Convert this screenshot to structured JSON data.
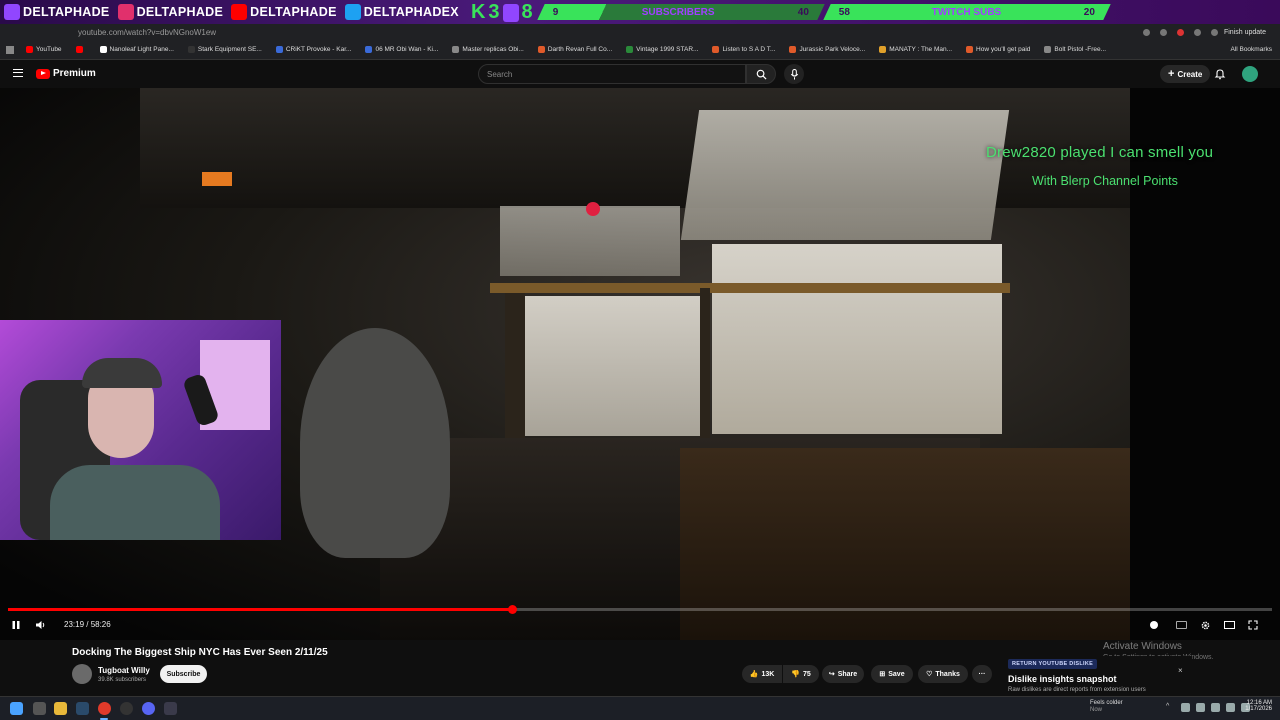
{
  "overlay_banner": {
    "socials": [
      {
        "icon": "twitch-icon",
        "handle": "DELTAPHADE",
        "color": "#9146ff"
      },
      {
        "icon": "instagram-icon",
        "handle": "DELTAPHADE",
        "color": "#e1306c"
      },
      {
        "icon": "youtube-icon",
        "handle": "DELTAPHADE",
        "color": "#ff0000"
      },
      {
        "icon": "twitter-icon",
        "handle": "DELTAPHADEX",
        "color": "#1da1f2"
      }
    ],
    "k38_letters": [
      "K",
      "3",
      "8"
    ],
    "subscribers": {
      "current": "9",
      "label": "SUBSCRIBERS",
      "goal": "40"
    },
    "twitch_subs": {
      "current": "58",
      "label": "TWITCH SUBS",
      "goal": "20"
    },
    "accent_green": "#39e35a"
  },
  "browser": {
    "url": "youtube.com/watch?v=dbvNGnoW1ew",
    "finish_update": "Finish update",
    "bookmarks": [
      {
        "label": "YouTube",
        "color": "#ff0000"
      },
      {
        "label": "",
        "color": "#ff0000"
      },
      {
        "label": "Nanoleaf Light Pane...",
        "color": "#ffffff"
      },
      {
        "label": "Stark Equipment SE...",
        "color": "#333333"
      },
      {
        "label": "CRiKT Provoke - Kar...",
        "color": "#3a6ad8"
      },
      {
        "label": "06 MR Obi Wan - Ki...",
        "color": "#3a6ad8"
      },
      {
        "label": "Master replicas Obi...",
        "color": "#888888"
      },
      {
        "label": "Darth Revan Full Co...",
        "color": "#e05a2a"
      },
      {
        "label": "Vintage 1999 STAR...",
        "color": "#2a8a3a"
      },
      {
        "label": "Listen to S A D  T...",
        "color": "#e05a2a"
      },
      {
        "label": "Jurassic Park Veloce...",
        "color": "#e05a2a"
      },
      {
        "label": "MANATY : The Man...",
        "color": "#e0a02a"
      },
      {
        "label": "How you'll get paid",
        "color": "#e05a2a"
      },
      {
        "label": "Bolt Pistol -Free...",
        "color": "#888888"
      }
    ],
    "all_bookmarks": "All Bookmarks"
  },
  "youtube": {
    "logo_text": "Premium",
    "search_placeholder": "Search",
    "create_label": "Create"
  },
  "video": {
    "alert_line1": "Drew2820 played I can smell you",
    "alert_line2": "With Blerp Channel Points",
    "time_current": "23:19",
    "time_total": "58:26",
    "time_display": "23:19 / 58:26",
    "progress_fraction": 0.399,
    "title": "Docking The Biggest Ship NYC Has Ever Seen 2/11/25",
    "channel": "Tugboat Willy",
    "subscribers": "39.8K subscribers",
    "subscribe_label": "Subscribe",
    "likes": "13K",
    "dislikes": "75",
    "share_label": "Share",
    "save_label": "Save",
    "thanks_label": "Thanks"
  },
  "windows": {
    "activate_title": "Activate Windows",
    "activate_sub": "Go to Settings to activate Windows.",
    "weather_line1": "Feels colder",
    "weather_line2": "Now",
    "time": "12:16 AM",
    "date": "1/17/2026"
  },
  "dislike_card": {
    "badge": "RETURN YOUTUBE DISLIKE",
    "title": "Dislike insights snapshot",
    "desc": "Raw dislikes are direct reports from extension users",
    "close": "×"
  }
}
